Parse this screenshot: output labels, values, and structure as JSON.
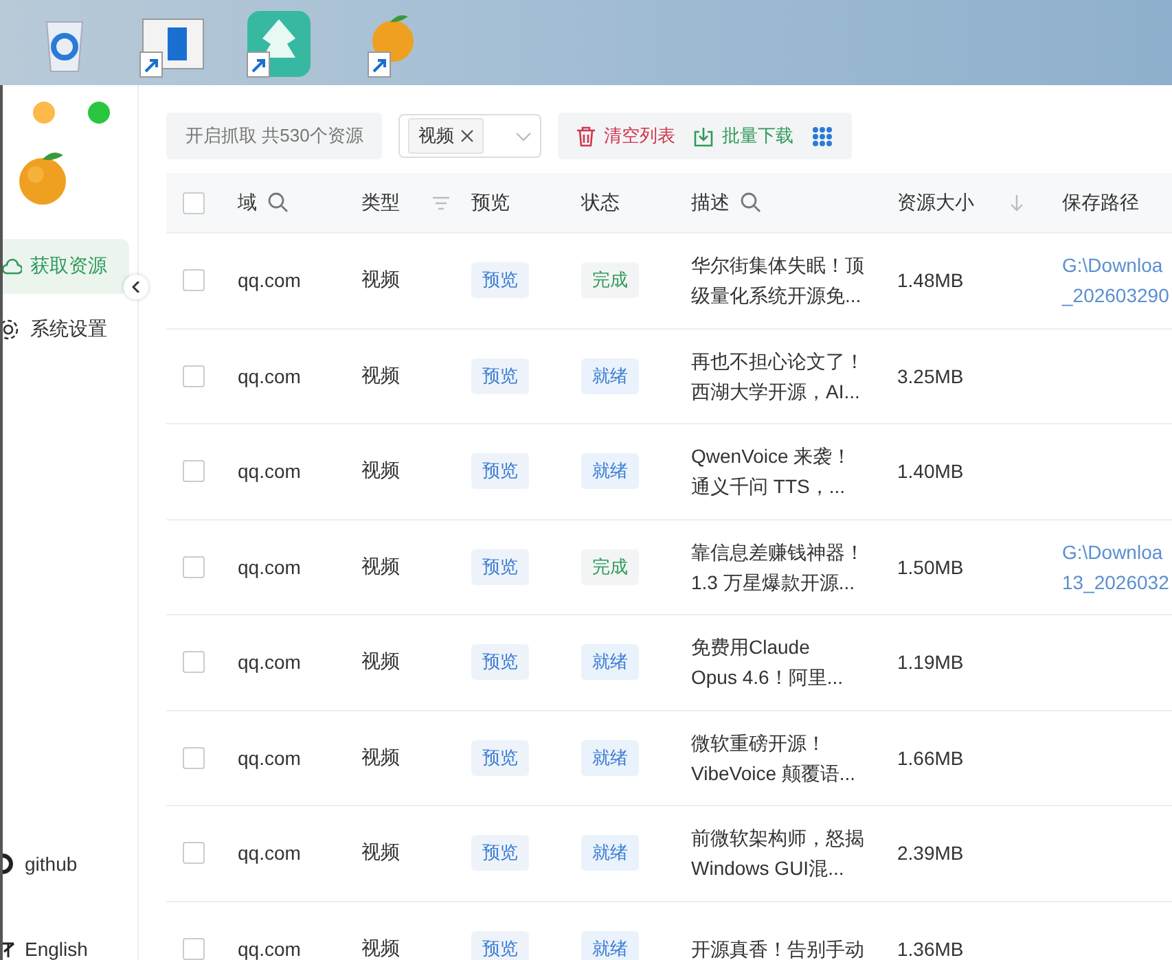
{
  "sidebar": {
    "items": [
      {
        "label": "获取资源",
        "selected": true
      },
      {
        "label": "系统设置",
        "selected": false
      }
    ],
    "footer": [
      {
        "label": "github"
      },
      {
        "label": "English"
      }
    ]
  },
  "toolbar": {
    "capture_button": "开启抓取 共530个资源",
    "filter_tag": "视频",
    "clear_button": "清空列表",
    "download_button": "批量下载"
  },
  "table": {
    "header_checked": false,
    "columns": [
      {
        "label": "域"
      },
      {
        "label": "类型"
      },
      {
        "label": "预览"
      },
      {
        "label": "状态"
      },
      {
        "label": "描述"
      },
      {
        "label": "资源大小"
      },
      {
        "label": "保存路径"
      }
    ],
    "rows": [
      {
        "checked": false,
        "domain": "qq.com",
        "type": "视频",
        "preview": "预览",
        "status": "完成",
        "complete": true,
        "desc_lines": [
          "华尔街集体失眠！顶",
          "级量化系统开源免..."
        ],
        "size": "1.48MB",
        "path_lines": [
          "G:\\Downloa",
          "_202603290"
        ]
      },
      {
        "checked": false,
        "domain": "qq.com",
        "type": "视频",
        "preview": "预览",
        "status": "就绪",
        "complete": false,
        "desc_lines": [
          "再也不担心论文了！",
          "西湖大学开源，AI..."
        ],
        "size": "3.25MB",
        "path_lines": []
      },
      {
        "checked": false,
        "domain": "qq.com",
        "type": "视频",
        "preview": "预览",
        "status": "就绪",
        "complete": false,
        "desc_lines": [
          "QwenVoice 来袭！",
          "通义千问 TTS，..."
        ],
        "size": "1.40MB",
        "path_lines": []
      },
      {
        "checked": false,
        "domain": "qq.com",
        "type": "视频",
        "preview": "预览",
        "status": "完成",
        "complete": true,
        "desc_lines": [
          "靠信息差赚钱神器！",
          "1.3 万星爆款开源..."
        ],
        "size": "1.50MB",
        "path_lines": [
          "G:\\Downloa",
          "13_2026032"
        ]
      },
      {
        "checked": false,
        "domain": "qq.com",
        "type": "视频",
        "preview": "预览",
        "status": "就绪",
        "complete": false,
        "desc_lines": [
          "免费用Claude",
          "Opus 4.6！阿里..."
        ],
        "size": "1.19MB",
        "path_lines": []
      },
      {
        "checked": false,
        "domain": "qq.com",
        "type": "视频",
        "preview": "预览",
        "status": "就绪",
        "complete": false,
        "desc_lines": [
          "微软重磅开源！",
          "VibeVoice 颠覆语..."
        ],
        "size": "1.66MB",
        "path_lines": []
      },
      {
        "checked": false,
        "domain": "qq.com",
        "type": "视频",
        "preview": "预览",
        "status": "就绪",
        "complete": false,
        "desc_lines": [
          "前微软架构师，怒揭",
          "Windows GUI混..."
        ],
        "size": "2.39MB",
        "path_lines": []
      },
      {
        "checked": false,
        "domain": "qq.com",
        "type": "视频",
        "preview": "预览",
        "status": "就绪",
        "complete": false,
        "desc_lines": [
          "开源真香！告别手动"
        ],
        "size": "1.36MB",
        "path_lines": []
      }
    ]
  }
}
